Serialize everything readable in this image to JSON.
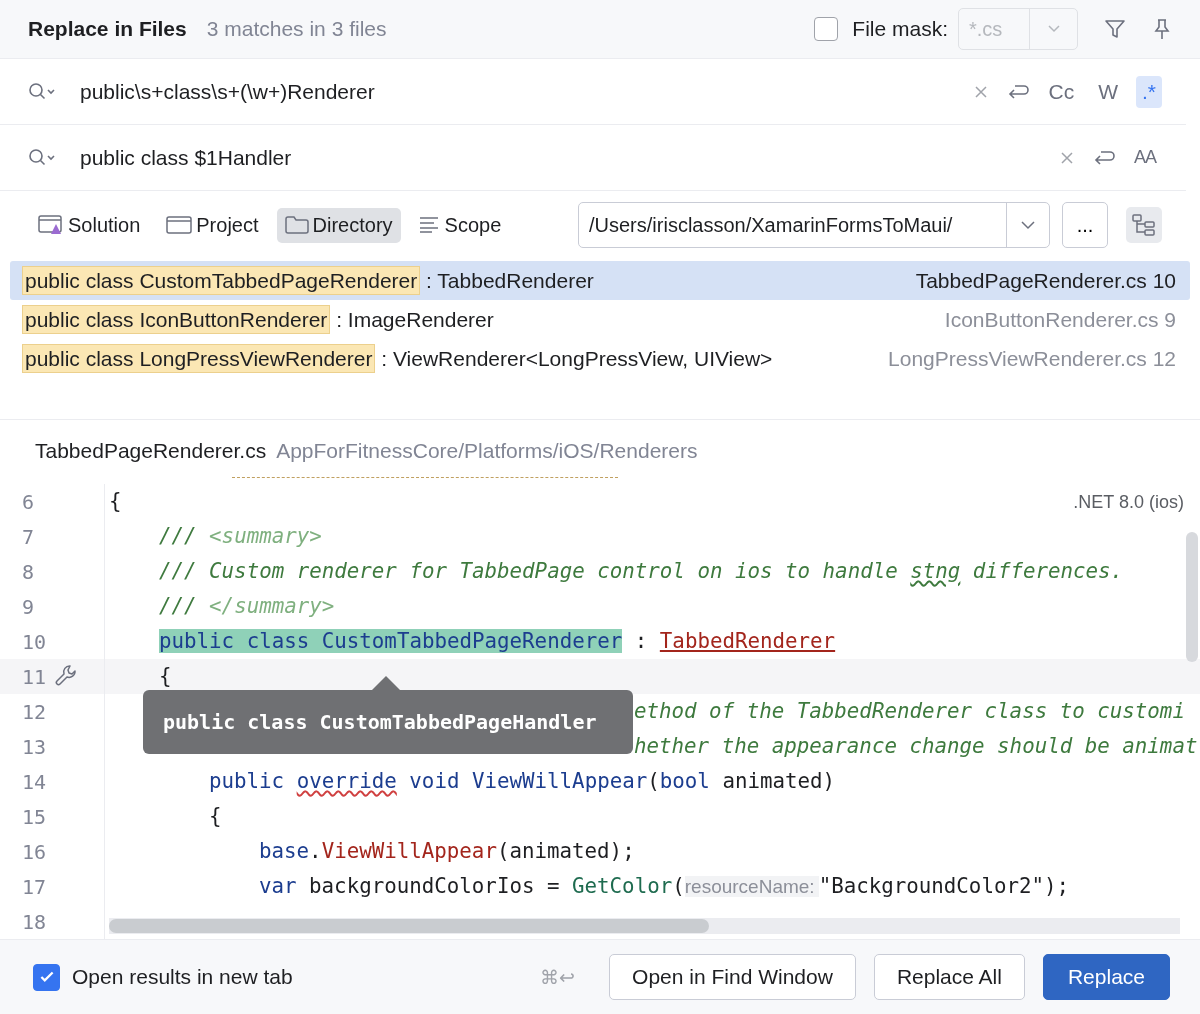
{
  "header": {
    "title": "Replace in Files",
    "summary": "3 matches in 3 files",
    "file_mask": {
      "label": "File mask:",
      "checked": false,
      "placeholder": "*.cs"
    }
  },
  "search": {
    "value": "public\\s+class\\s+(\\w+)Renderer",
    "options": [
      {
        "label": "Cc",
        "selected": false
      },
      {
        "label": "W",
        "selected": false
      },
      {
        "label": ".*",
        "selected": true
      }
    ]
  },
  "replace": {
    "value": "public class $1Handler",
    "preserve_case": {
      "label": "AA",
      "selected": false
    }
  },
  "scopes": [
    {
      "kind": "solution",
      "label": "Solution",
      "selected": false
    },
    {
      "kind": "project",
      "label": "Project",
      "selected": false
    },
    {
      "kind": "directory",
      "label": "Directory",
      "selected": true
    },
    {
      "kind": "scope",
      "label": "Scope",
      "selected": false
    }
  ],
  "directory": {
    "value": "/Users/irisclasson/XamarinFormsToMaui/",
    "more": "..."
  },
  "results": [
    {
      "match": "public class CustomTabbedPageRenderer",
      "rest": " : TabbedRenderer",
      "file": "TabbedPageRenderer.cs 10",
      "selected": true
    },
    {
      "match": "public class IconButtonRenderer",
      "rest": " : ImageRenderer",
      "file": "IconButtonRenderer.cs 9",
      "selected": false
    },
    {
      "match": "public class LongPressViewRenderer",
      "rest": " : ViewRenderer<LongPressView, UIView>",
      "file": "LongPressViewRenderer.cs 12",
      "selected": false
    }
  ],
  "preview": {
    "file": "TabbedPageRenderer.cs",
    "path": "AppForFitnessCore/Platforms/iOS/Renderers",
    "framework": ".NET 8.0 (ios)",
    "lines": [
      {
        "number": "6",
        "current": false,
        "tools": false,
        "covered": false,
        "tokens": [
          {
            "kind": "plain",
            "text": "{"
          }
        ],
        "children": [
          {
            "number": "7",
            "current": false,
            "tools": false,
            "covered": false,
            "tokens": [
              {
                "kind": "doc",
                "text": "/// "
              },
              {
                "kind": "doctag",
                "text": "<summary>"
              }
            ]
          },
          {
            "number": "8",
            "current": false,
            "tools": false,
            "covered": false,
            "tokens": [
              {
                "kind": "doc",
                "text": "/// Custom renderer for TabbedPage control on ios to handle "
              },
              {
                "kind": "doc_squiggle",
                "text": "stng"
              },
              {
                "kind": "doc",
                "text": " differences."
              }
            ]
          },
          {
            "number": "9",
            "current": false,
            "tools": false,
            "covered": false,
            "tokens": [
              {
                "kind": "doc",
                "text": "/// "
              },
              {
                "kind": "doctag",
                "text": "</summary>"
              }
            ]
          },
          {
            "number": "10",
            "current": false,
            "tools": false,
            "covered": false,
            "tokens": [
              {
                "kind": "match",
                "text": "public class CustomTabbedPageRenderer"
              },
              {
                "kind": "plain",
                "text": " : "
              },
              {
                "kind": "error_type",
                "text": "TabbedRenderer"
              }
            ]
          },
          {
            "number": "11",
            "current": true,
            "tools": true,
            "covered": false,
            "tokens": [
              {
                "kind": "plain",
                "text": "{"
              }
            ],
            "children": [
              {
                "number": "12",
                "current": false,
                "tools": false,
                "covered": true,
                "tokens": [
                  {
                    "kind": "doc",
                    "text": "ethod of the TabbedRenderer class to customi"
                  }
                ]
              },
              {
                "number": "13",
                "current": false,
                "tools": false,
                "covered": true,
                "tokens": [
                  {
                    "kind": "doc",
                    "text": "hether the appearance change should be animat"
                  }
                ]
              },
              {
                "number": "14",
                "current": false,
                "tools": false,
                "covered": false,
                "tokens": [
                  {
                    "kind": "kw",
                    "text": "public "
                  },
                  {
                    "kind": "kw_squiggle",
                    "text": "override"
                  },
                  {
                    "kind": "kw",
                    "text": " void ViewWillAppear"
                  },
                  {
                    "kind": "plain",
                    "text": "("
                  },
                  {
                    "kind": "kw",
                    "text": "bool"
                  },
                  {
                    "kind": "plain",
                    "text": " animated)"
                  }
                ]
              },
              {
                "number": "15",
                "current": false,
                "tools": false,
                "covered": false,
                "tokens": [
                  {
                    "kind": "plain",
                    "text": "{"
                  }
                ],
                "children": [
                  {
                    "number": "16",
                    "current": false,
                    "tools": false,
                    "covered": false,
                    "tokens": [
                      {
                        "kind": "kw",
                        "text": "base"
                      },
                      {
                        "kind": "plain",
                        "text": "."
                      },
                      {
                        "kind": "method",
                        "text": "ViewWillAppear"
                      },
                      {
                        "kind": "plain",
                        "text": "(animated);"
                      }
                    ]
                  },
                  {
                    "number": "17",
                    "current": false,
                    "tools": false,
                    "covered": false,
                    "tokens": [
                      {
                        "kind": "kw",
                        "text": "var"
                      },
                      {
                        "kind": "plain",
                        "text": " backgroundColorIos = "
                      },
                      {
                        "kind": "call",
                        "text": "GetColor"
                      },
                      {
                        "kind": "plain",
                        "text": "("
                      },
                      {
                        "kind": "hint",
                        "text": "resourceName:"
                      },
                      {
                        "kind": "string",
                        "text": "\"BackgroundColor2\""
                      },
                      {
                        "kind": "plain",
                        "text": ");"
                      }
                    ]
                  },
                  {
                    "number": "18",
                    "current": false,
                    "tools": false,
                    "covered": false
                  }
                ]
              }
            ]
          }
        ]
      }
    ],
    "tooltip": "public class CustomTabbedPageHandler"
  },
  "footer": {
    "open_new_tab": {
      "label": "Open results in new tab",
      "checked": true
    },
    "shortcut": "⌘↩",
    "buttons": [
      {
        "label": "Open in Find Window",
        "kind": "default"
      },
      {
        "label": "Replace All",
        "kind": "default"
      },
      {
        "label": "Replace",
        "kind": "primary"
      }
    ]
  }
}
